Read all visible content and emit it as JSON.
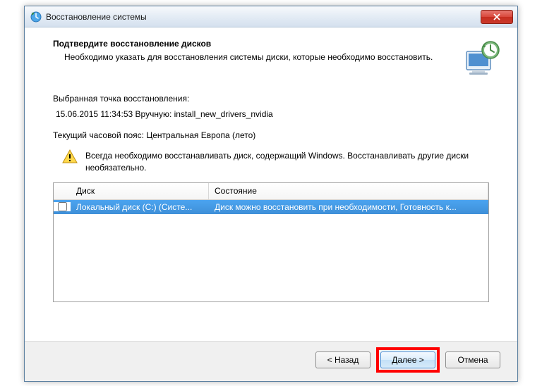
{
  "window": {
    "title": "Восстановление системы"
  },
  "header": {
    "title": "Подтвердите восстановление дисков",
    "description": "Необходимо указать для восстановления системы диски, которые необходимо восстановить."
  },
  "info": {
    "selected_point_label": "Выбранная точка восстановления:",
    "selected_point_value": "15.06.2015 11:34:53 Вручную: install_new_drivers_nvidia",
    "timezone": "Текущий часовой пояс: Центральная Европа (лето)"
  },
  "warning": {
    "text": "Всегда необходимо восстанавливать диск, содержащий Windows. Восстанавливать другие диски необязательно."
  },
  "table": {
    "headers": {
      "disk": "Диск",
      "status": "Состояние"
    },
    "rows": [
      {
        "checked": false,
        "disk": "Локальный диск (C:) (Систе...",
        "status": "Диск можно восстановить при необходимости, Готовность к..."
      }
    ]
  },
  "buttons": {
    "back": "< Назад",
    "next": "Далее >",
    "cancel": "Отмена"
  }
}
